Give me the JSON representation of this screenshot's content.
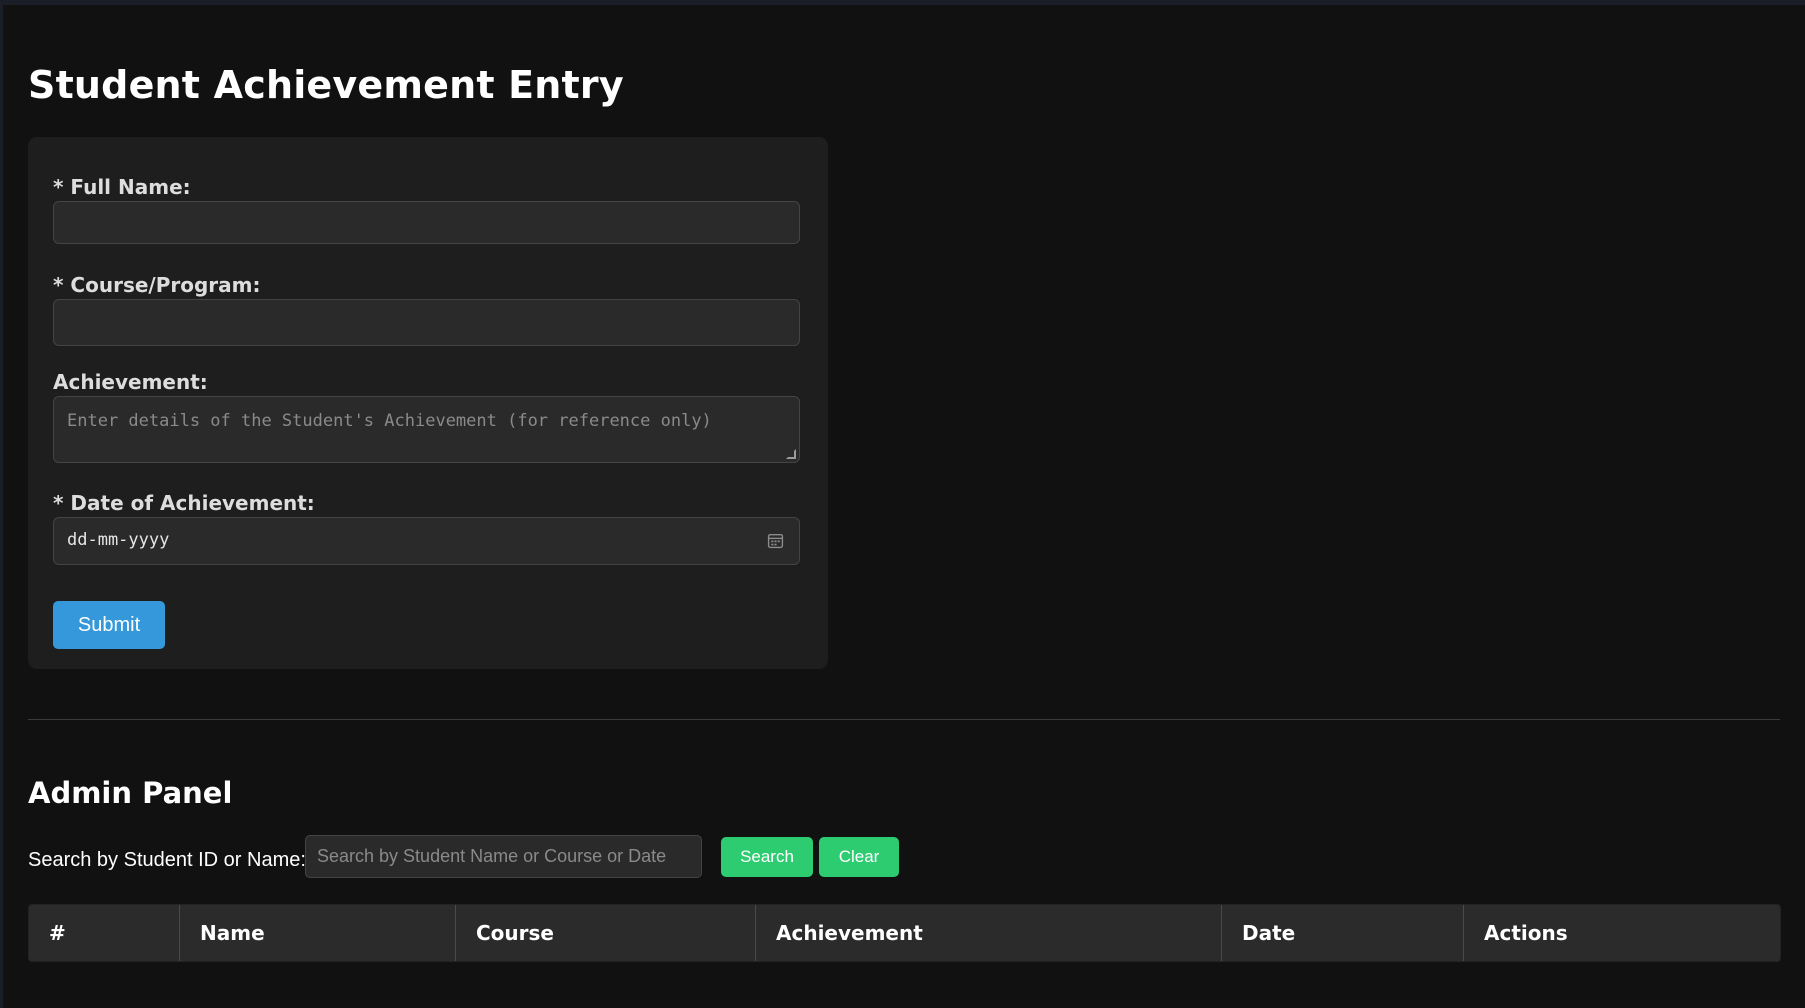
{
  "page": {
    "title": "Student Achievement Entry"
  },
  "form": {
    "full_name": {
      "label": "* Full Name:",
      "value": ""
    },
    "course": {
      "label": "* Course/Program:",
      "value": ""
    },
    "achievement": {
      "label": "Achievement:",
      "placeholder": "Enter details of the Student's Achievement (for reference only)"
    },
    "date": {
      "label": "* Date of Achievement:",
      "value": "dd-mm-yyyy",
      "icon": "calendar-icon"
    },
    "submit_label": "Submit"
  },
  "admin": {
    "title": "Admin Panel",
    "search_label": "Search by Student ID or Name:",
    "search_placeholder": "Search by Student Name or Course or Date",
    "search_button": "Search",
    "clear_button": "Clear",
    "table": {
      "headers": [
        "#",
        "Name",
        "Course",
        "Achievement",
        "Date",
        "Actions"
      ],
      "rows": []
    }
  },
  "colors": {
    "background": "#111111",
    "card": "#1e1e1e",
    "primary_button": "#3498db",
    "secondary_button": "#2ecc71"
  }
}
